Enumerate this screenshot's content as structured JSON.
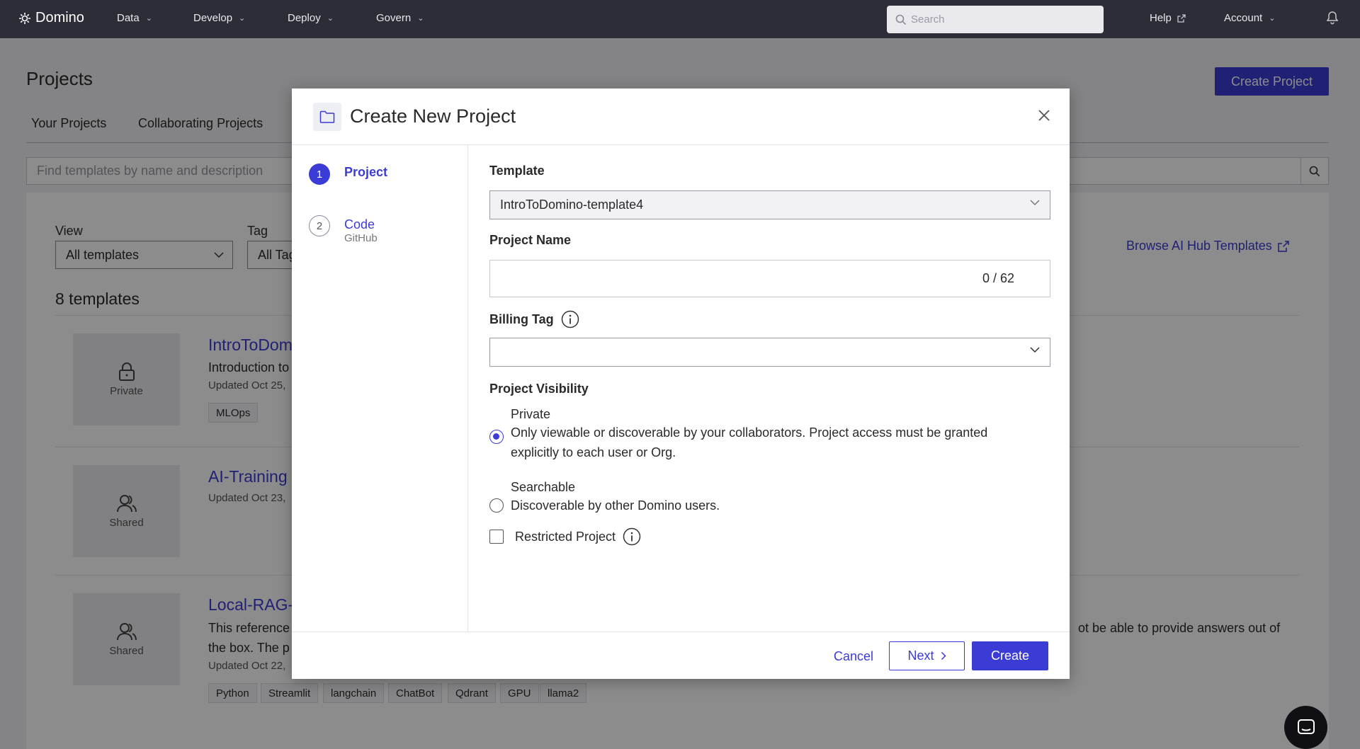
{
  "topnav": {
    "brand": "Domino",
    "menus": [
      "Data",
      "Develop",
      "Deploy",
      "Govern"
    ],
    "search_placeholder": "Search",
    "help": "Help",
    "account": "Account"
  },
  "page": {
    "title": "Projects",
    "create_button": "Create Project",
    "tabs": [
      "Your Projects",
      "Collaborating Projects"
    ],
    "find_placeholder": "Find templates by name and description",
    "view_label": "View",
    "view_value": "All templates",
    "tag_label": "Tag",
    "tag_value": "All Tag",
    "browse_link": "Browse AI Hub Templates",
    "count": "8 templates"
  },
  "templates": [
    {
      "visibility": "Private",
      "name": "IntroToDom",
      "desc": "Introduction to",
      "updated": "Updated Oct 25,",
      "tags": [
        "MLOps"
      ]
    },
    {
      "visibility": "Shared",
      "name": "AI-Training",
      "desc": "",
      "updated": "Updated Oct 23,",
      "tags": []
    },
    {
      "visibility": "Shared",
      "name": "Local-RAG-",
      "desc": "This reference",
      "desc2": "the box. The p",
      "desc_tail": "ot be able to provide answers out of",
      "updated": "Updated Oct 22,",
      "tags": [
        "Python",
        "Streamlit",
        "langchain",
        "ChatBot",
        "Qdrant",
        "GPU",
        "llama2"
      ]
    }
  ],
  "modal": {
    "title": "Create New Project",
    "steps": [
      {
        "num": "1",
        "label": "Project",
        "sub": ""
      },
      {
        "num": "2",
        "label": "Code",
        "sub": "GitHub"
      }
    ],
    "template_label": "Template",
    "template_value": "IntroToDomino-template4",
    "project_name_label": "Project Name",
    "project_name_value": "",
    "project_name_counter": "0 / 62",
    "billing_tag_label": "Billing Tag",
    "billing_tag_value": "",
    "visibility_label": "Project Visibility",
    "visibility_options": [
      {
        "title": "Private",
        "desc": "Only viewable or discoverable by your collaborators. Project access must be granted explicitly to each user or Org.",
        "checked": true
      },
      {
        "title": "Searchable",
        "desc": "Discoverable by other Domino users.",
        "checked": false
      }
    ],
    "restricted_label": "Restricted Project",
    "cancel": "Cancel",
    "next": "Next",
    "create": "Create"
  },
  "colors": {
    "accent": "#3b3bd6",
    "nav_bg": "#2d2d38"
  }
}
